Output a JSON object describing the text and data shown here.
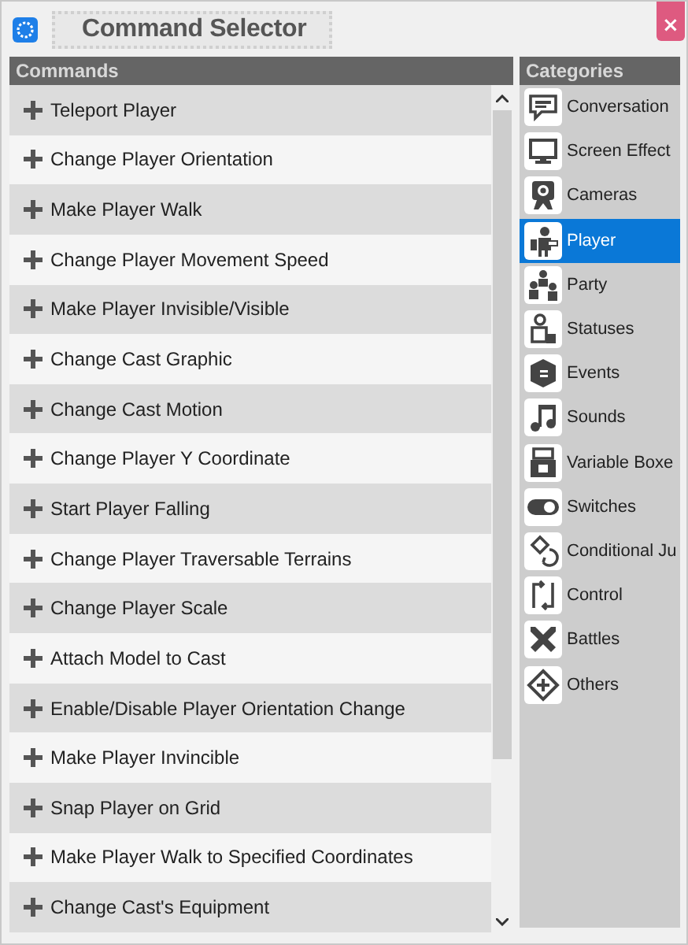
{
  "window": {
    "title": "Command Selector",
    "close": "×"
  },
  "commands": {
    "header": "Commands",
    "items": [
      {
        "label": "Teleport Player"
      },
      {
        "label": "Change Player Orientation"
      },
      {
        "label": "Make Player Walk"
      },
      {
        "label": "Change Player Movement Speed"
      },
      {
        "label": "Make Player Invisible/Visible"
      },
      {
        "label": "Change Cast Graphic"
      },
      {
        "label": "Change Cast Motion"
      },
      {
        "label": "Change Player Y Coordinate"
      },
      {
        "label": "Start Player Falling"
      },
      {
        "label": "Change Player Traversable Terrains"
      },
      {
        "label": "Change Player Scale"
      },
      {
        "label": "Attach Model to Cast"
      },
      {
        "label": "Enable/Disable Player Orientation Change"
      },
      {
        "label": "Make Player Invincible"
      },
      {
        "label": "Snap Player on Grid"
      },
      {
        "label": "Make Player Walk to Specified Coordinates"
      },
      {
        "label": "Change Cast's Equipment"
      }
    ]
  },
  "categories": {
    "header": "Categories",
    "items": [
      {
        "label": "Conversation",
        "selected": false
      },
      {
        "label": "Screen Effect",
        "selected": false
      },
      {
        "label": "Cameras",
        "selected": false
      },
      {
        "label": "Player",
        "selected": true
      },
      {
        "label": "Party",
        "selected": false
      },
      {
        "label": "Statuses",
        "selected": false
      },
      {
        "label": "Events",
        "selected": false
      },
      {
        "label": "Sounds",
        "selected": false
      },
      {
        "label": "Variable Boxe",
        "selected": false
      },
      {
        "label": "Switches",
        "selected": false
      },
      {
        "label": "Conditional Ju",
        "selected": false
      },
      {
        "label": "Control",
        "selected": false
      },
      {
        "label": "Battles",
        "selected": false
      },
      {
        "label": "Others",
        "selected": false
      }
    ]
  }
}
